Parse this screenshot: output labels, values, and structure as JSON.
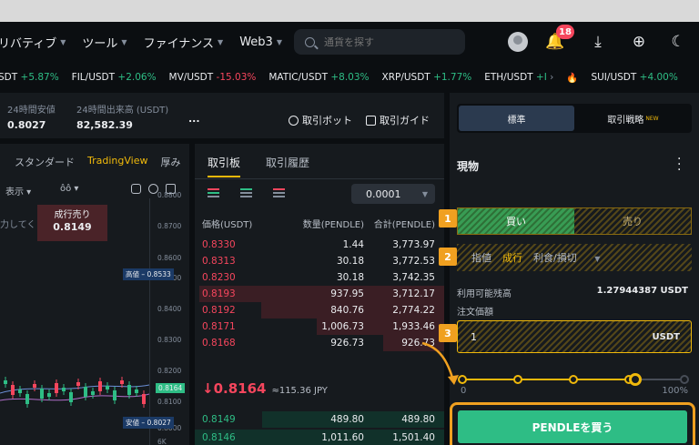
{
  "nav": {
    "items": [
      "リバティブ",
      "ツール",
      "ファイナンス",
      "Web3"
    ],
    "search_placeholder": "通貨を探す",
    "notification_count": "18"
  },
  "ticker": [
    {
      "pair": "SDT",
      "change": "+5.87%",
      "dir": "up"
    },
    {
      "pair": "FIL/USDT",
      "change": "+2.06%",
      "dir": "up"
    },
    {
      "pair": "MV/USDT",
      "change": "-15.03%",
      "dir": "dn"
    },
    {
      "pair": "MATIC/USDT",
      "change": "+8.03%",
      "dir": "up"
    },
    {
      "pair": "XRP/USDT",
      "change": "+1.77%",
      "dir": "up"
    },
    {
      "pair": "ETH/USDT",
      "change": "+I",
      "dir": "up"
    },
    {
      "pair": "SUI/USDT",
      "change": "+4.00%",
      "dir": "up"
    }
  ],
  "stats": {
    "high_label": "24時間安値",
    "high_value": "0.8027",
    "volume_label": "24時間出来高 (USDT)",
    "volume_value": "82,582.39",
    "more": "...",
    "bot_link": "取引ボット",
    "guide_link": "取引ガイド"
  },
  "chart": {
    "tabs": [
      "スタンダード",
      "TradingView",
      "厚み"
    ],
    "active_tab": "TradingView",
    "tool_display": "表示",
    "tool_indicator": "ôô",
    "sell_label": "成行売り",
    "sell_price": "0.8149",
    "sell_left": "力してく",
    "axis": [
      "0.8800",
      "0.8700",
      "0.8600",
      "0.8500",
      "0.8400",
      "0.8300",
      "0.8200",
      "0.8100",
      "0.8000",
      "6K"
    ],
    "high_tag_label": "高値",
    "high_tag_value": "0.8533",
    "current_tag": "0.8164",
    "low_tag_label": "安値",
    "low_tag_value": "0.8027"
  },
  "orderbook": {
    "tabs": [
      "取引板",
      "取引履歴"
    ],
    "precision": "0.0001",
    "headers": [
      "価格(USDT)",
      "数量(PENDLE)",
      "合計(PENDLE)"
    ],
    "asks": [
      {
        "price": "0.8330",
        "qty": "1.44",
        "total": "3,773.97"
      },
      {
        "price": "0.8313",
        "qty": "30.18",
        "total": "3,772.53"
      },
      {
        "price": "0.8230",
        "qty": "30.18",
        "total": "3,742.35"
      },
      {
        "price": "0.8193",
        "qty": "937.95",
        "total": "3,712.17"
      },
      {
        "price": "0.8192",
        "qty": "840.76",
        "total": "2,774.22"
      },
      {
        "price": "0.8171",
        "qty": "1,006.73",
        "total": "1,933.46"
      },
      {
        "price": "0.8168",
        "qty": "926.73",
        "total": "926.73"
      }
    ],
    "last_price": "↓0.8164",
    "last_price_jpy": "≈115.36 JPY",
    "bids": [
      {
        "price": "0.8149",
        "qty": "489.80",
        "total": "489.80"
      },
      {
        "price": "0.8146",
        "qty": "1,011.60",
        "total": "1,501.40"
      }
    ]
  },
  "trade": {
    "mode_standard": "標準",
    "mode_strategy": "取引戦略",
    "mode_new": "NEW",
    "title": "現物",
    "buy": "買い",
    "sell": "売り",
    "order_types": [
      "指値",
      "成行",
      "利食/損切"
    ],
    "active_order_type": "成行",
    "available_label": "利用可能残高",
    "available_value": "1.27944387 USDT",
    "price_label": "注文価額",
    "price_value": "1",
    "price_unit": "USDT",
    "slider_min": "0",
    "slider_max": "100%",
    "slider_fraction": 0.78,
    "buy_button": "PENDLEを買う",
    "steps": [
      "1",
      "2",
      "3"
    ]
  }
}
